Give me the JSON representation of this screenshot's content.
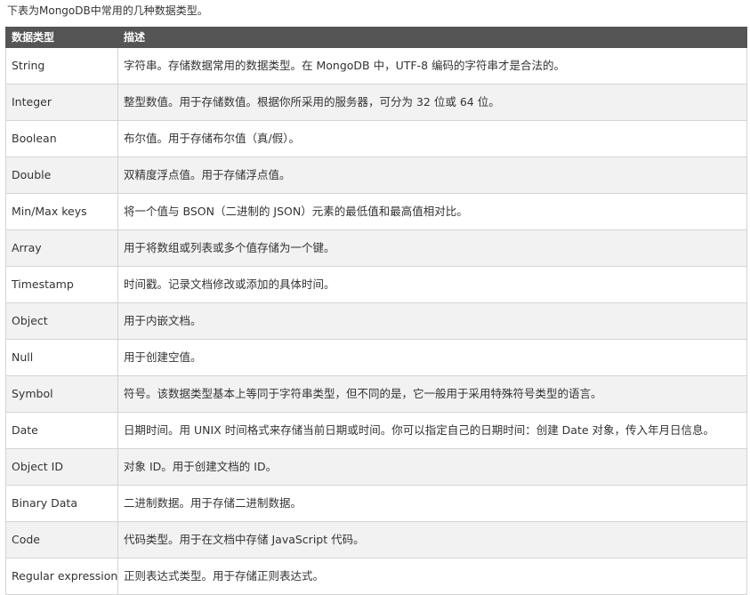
{
  "intro_text": "下表为MongoDB中常用的几种数据类型。",
  "table": {
    "headers": [
      "数据类型",
      "描述"
    ],
    "rows": [
      {
        "type": "String",
        "desc": "字符串。存储数据常用的数据类型。在 MongoDB 中，UTF-8 编码的字符串才是合法的。"
      },
      {
        "type": "Integer",
        "desc": "整型数值。用于存储数值。根据你所采用的服务器，可分为 32 位或 64 位。"
      },
      {
        "type": "Boolean",
        "desc": "布尔值。用于存储布尔值（真/假）。"
      },
      {
        "type": "Double",
        "desc": "双精度浮点值。用于存储浮点值。"
      },
      {
        "type": "Min/Max keys",
        "desc": "将一个值与 BSON（二进制的 JSON）元素的最低值和最高值相对比。"
      },
      {
        "type": "Array",
        "desc": "用于将数组或列表或多个值存储为一个键。"
      },
      {
        "type": "Timestamp",
        "desc": "时间戳。记录文档修改或添加的具体时间。"
      },
      {
        "type": "Object",
        "desc": "用于内嵌文档。"
      },
      {
        "type": "Null",
        "desc": "用于创建空值。"
      },
      {
        "type": "Symbol",
        "desc": "符号。该数据类型基本上等同于字符串类型，但不同的是，它一般用于采用特殊符号类型的语言。"
      },
      {
        "type": "Date",
        "desc": "日期时间。用 UNIX 时间格式来存储当前日期或时间。你可以指定自己的日期时间：创建 Date 对象，传入年月日信息。"
      },
      {
        "type": "Object ID",
        "desc": "对象 ID。用于创建文档的 ID。"
      },
      {
        "type": "Binary Data",
        "desc": "二进制数据。用于存储二进制数据。"
      },
      {
        "type": "Code",
        "desc": "代码类型。用于在文档中存储 JavaScript 代码。"
      },
      {
        "type": "Regular expression",
        "desc": "正则表达式类型。用于存储正则表达式。"
      }
    ]
  },
  "colors": {
    "header_bg": "#555555",
    "header_text": "#ffffff",
    "row_alt_bg": "#f2f2f2",
    "border": "#d4d4d4"
  }
}
